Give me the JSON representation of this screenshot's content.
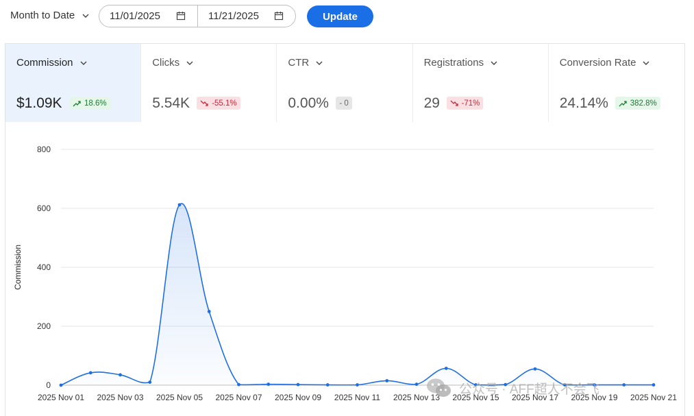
{
  "filters": {
    "range_label": "Month to Date",
    "start_date": "11/01/2025",
    "end_date": "11/21/2025",
    "update_label": "Update"
  },
  "metrics": [
    {
      "label": "Commission",
      "value": "$1.09K",
      "change": "18.6%",
      "trend": "up",
      "active": true
    },
    {
      "label": "Clicks",
      "value": "5.54K",
      "change": "-55.1%",
      "trend": "down",
      "active": false
    },
    {
      "label": "CTR",
      "value": "0.00%",
      "change": "- 0",
      "trend": "flat",
      "active": false
    },
    {
      "label": "Registrations",
      "value": "29",
      "change": "-71%",
      "trend": "down",
      "active": false
    },
    {
      "label": "Conversion Rate",
      "value": "24.14%",
      "change": "382.8%",
      "trend": "up",
      "active": false
    }
  ],
  "colors": {
    "accent": "#1a6ee6",
    "line": "#1f6fe0",
    "up_bg": "#e4f7e8",
    "down_bg": "#fbe0e3"
  },
  "watermark": {
    "text": "公众号 · AFF超人不会飞",
    "icon": "wechat-icon"
  },
  "chart_data": {
    "type": "line",
    "title": "",
    "xlabel": "",
    "ylabel": "Commission",
    "ylim": [
      0,
      800
    ],
    "yticks": [
      0,
      200,
      400,
      600,
      800
    ],
    "x": [
      "2025 Nov 01",
      "2025 Nov 02",
      "2025 Nov 03",
      "2025 Nov 04",
      "2025 Nov 05",
      "2025 Nov 06",
      "2025 Nov 07",
      "2025 Nov 08",
      "2025 Nov 09",
      "2025 Nov 10",
      "2025 Nov 11",
      "2025 Nov 12",
      "2025 Nov 13",
      "2025 Nov 14",
      "2025 Nov 15",
      "2025 Nov 16",
      "2025 Nov 17",
      "2025 Nov 18",
      "2025 Nov 19",
      "2025 Nov 20",
      "2025 Nov 21"
    ],
    "xtick_labels": [
      "2025 Nov 01",
      "2025 Nov 03",
      "2025 Nov 05",
      "2025 Nov 07",
      "2025 Nov 09",
      "2025 Nov 11",
      "2025 Nov 13",
      "2025 Nov 15",
      "2025 Nov 17",
      "2025 Nov 19",
      "2025 Nov 21"
    ],
    "series": [
      {
        "values": [
          0,
          42,
          35,
          10,
          612,
          250,
          2,
          3,
          2,
          1,
          1,
          15,
          3,
          57,
          1,
          2,
          55,
          1,
          1,
          1,
          1
        ]
      }
    ],
    "grid": true,
    "legend": "none"
  }
}
